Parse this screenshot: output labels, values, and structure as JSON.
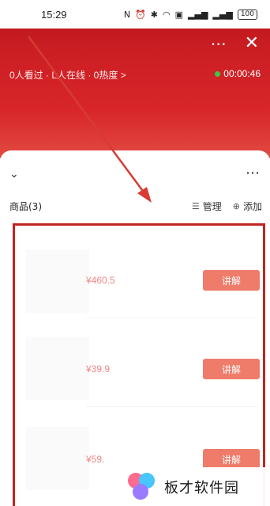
{
  "status_bar": {
    "time": "15:29",
    "icons": [
      "nfc-icon",
      "alarm-icon",
      "bluetooth-icon",
      "wifi-icon",
      "hd-icon",
      "signal-icon",
      "signal-icon"
    ],
    "battery": "100"
  },
  "header": {
    "more_icon": "⋯",
    "close_icon": "✕",
    "stats": "0人看过 · L人在线 · 0热度 >",
    "timer": "00:00:46",
    "live_dot_color": "#3ec44b",
    "accent_red": "#d8262a"
  },
  "sheet": {
    "collapse_icon": "⌄",
    "more_icon": "⋯",
    "goods_title": "商品(3)",
    "manage_label": "管理",
    "add_label": "添加"
  },
  "products": [
    {
      "price": "¥460.5",
      "button": "讲解"
    },
    {
      "price": "¥39.9",
      "button": "讲解"
    },
    {
      "price": "¥59.",
      "button": "讲解"
    }
  ],
  "watermark": {
    "text": "板才软件园"
  },
  "colors": {
    "price_color": "#f08a86",
    "button_color": "#ef7b6a",
    "highlight_frame": "#c2241f"
  }
}
